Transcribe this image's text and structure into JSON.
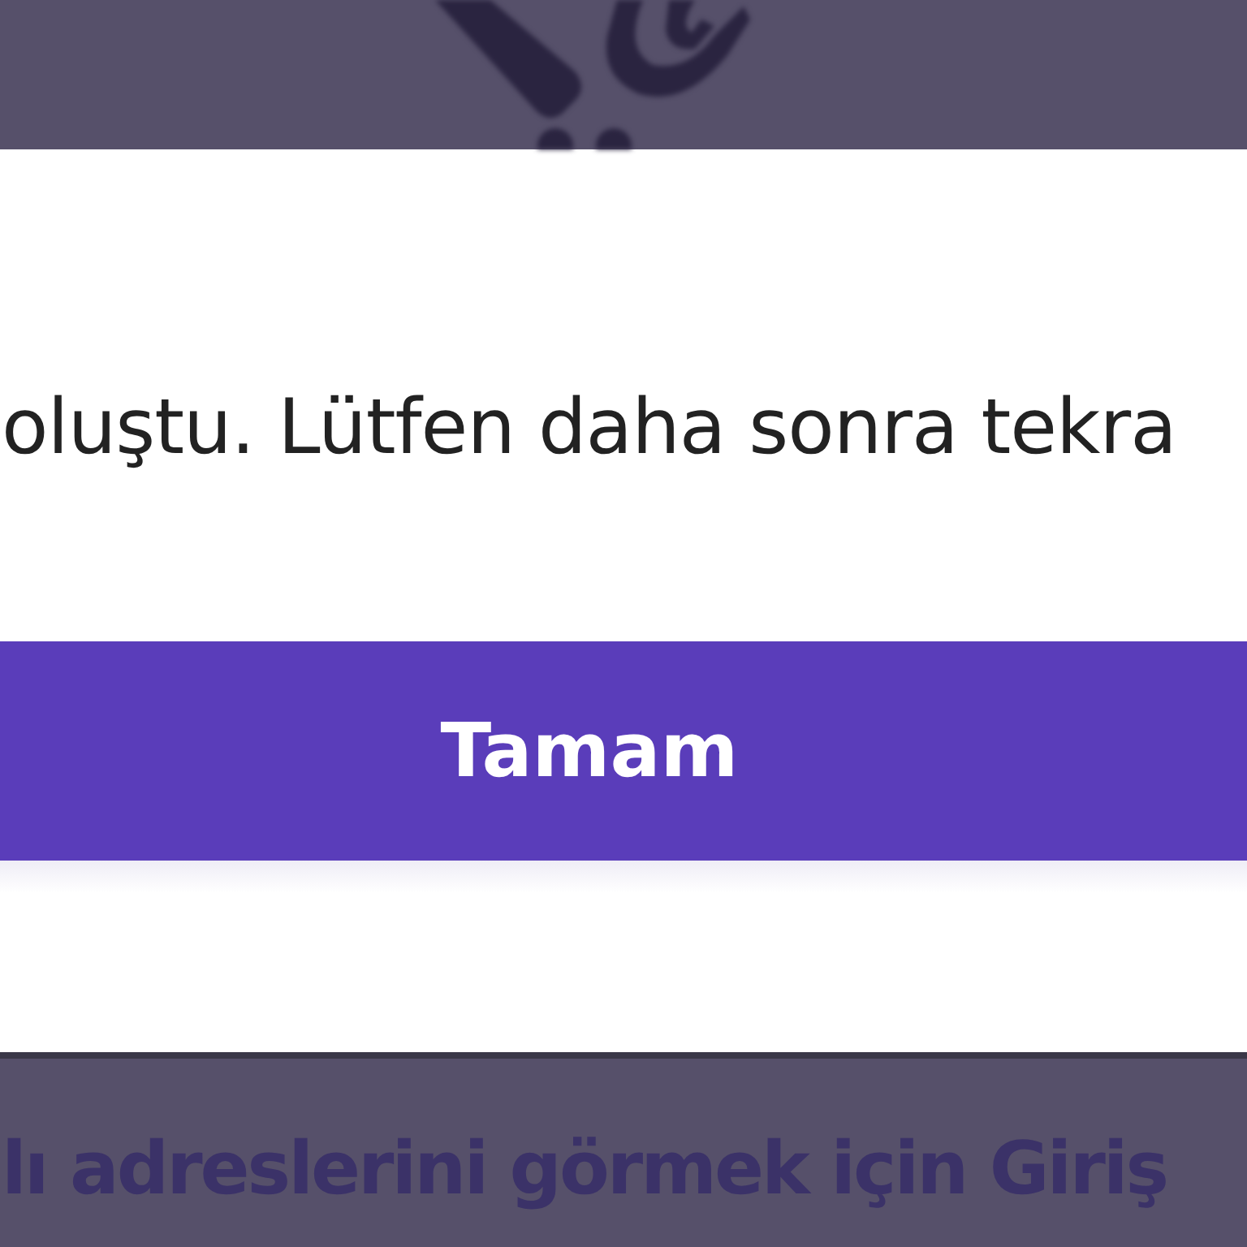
{
  "dialog": {
    "message": "oluştu. Lütfen daha sonra tekra",
    "button": "Tamam"
  },
  "background": {
    "heading": "lı adreslerini görmek için Giriş"
  }
}
